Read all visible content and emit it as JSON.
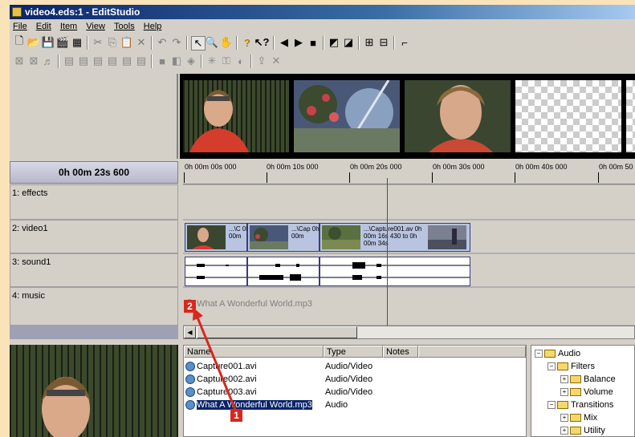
{
  "window": {
    "title": "video4.eds:1 - EditStudio"
  },
  "menu": [
    "File",
    "Edit",
    "Item",
    "View",
    "Tools",
    "Help"
  ],
  "timeline": {
    "position": "0h 00m 23s 600",
    "ruler": [
      "0h 00m 00s 000",
      "0h 00m 10s 000",
      "0h 00m 20s 000",
      "0h 00m 30s 000",
      "0h 00m 40s 000",
      "0h 00m 50"
    ],
    "tracks": [
      "1: effects",
      "2: video1",
      "3: sound1",
      "4: music"
    ],
    "video_clips": [
      {
        "text": "...\\C 0h 00m"
      },
      {
        "text": "...\\Cap 0h 00m"
      },
      {
        "text": "...\\Capture001.av 0h 00m 16s 430 to 0h 00m 34s"
      }
    ],
    "music_label": "What A Wonderful World.mp3"
  },
  "files": {
    "columns": [
      "Name",
      "Type",
      "Notes"
    ],
    "rows": [
      {
        "name": "Capture001.avi",
        "type": "Audio/Video"
      },
      {
        "name": "Capture002.avi",
        "type": "Audio/Video"
      },
      {
        "name": "Capture003.avi",
        "type": "Audio/Video"
      },
      {
        "name": "What A Wonderful World.mp3",
        "type": "Audio",
        "selected": true
      }
    ]
  },
  "tree": [
    {
      "label": "Audio",
      "sign": "−",
      "level": 0
    },
    {
      "label": "Filters",
      "sign": "−",
      "level": 1
    },
    {
      "label": "Balance",
      "sign": "+",
      "level": 2
    },
    {
      "label": "Volume",
      "sign": "+",
      "level": 2
    },
    {
      "label": "Transitions",
      "sign": "−",
      "level": 1
    },
    {
      "label": "Mix",
      "sign": "+",
      "level": 2
    },
    {
      "label": "Utility",
      "sign": "+",
      "level": 2
    }
  ],
  "annotations": {
    "step1": "1",
    "step2": "2",
    "color": "#d7281e"
  }
}
